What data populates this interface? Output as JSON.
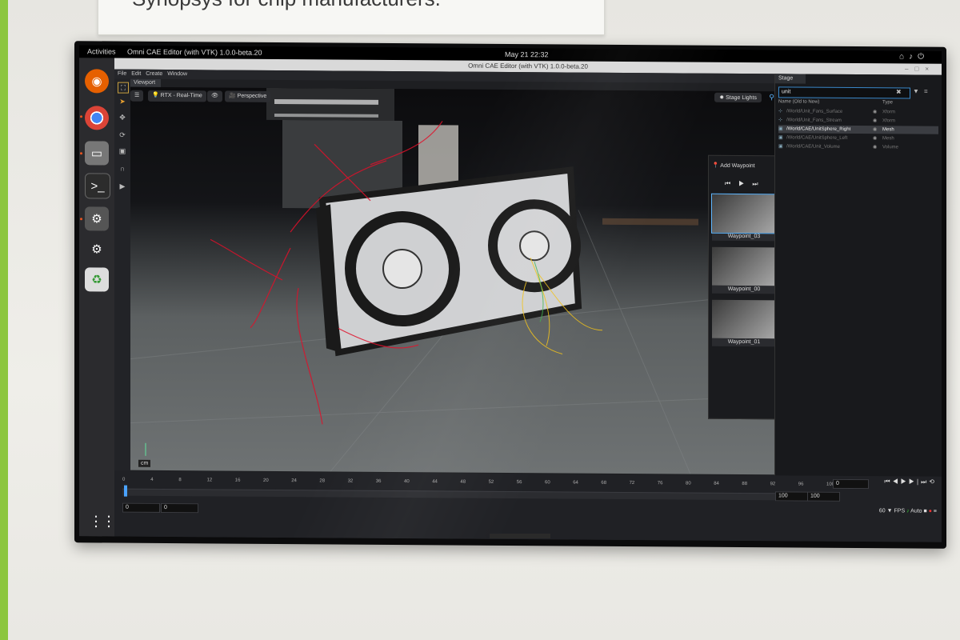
{
  "banner": {
    "text": "Synopsys for chip manufacturers."
  },
  "gnome": {
    "activities": "Activities",
    "app_title": "Omni CAE Editor (with VTK) 1.0.0-beta.20",
    "clock": "May 21  22:32",
    "tray_icons": [
      "network-icon",
      "volume-icon",
      "power-icon"
    ]
  },
  "dock": {
    "items": [
      "firefox-icon",
      "chrome-icon",
      "files-icon",
      "terminal-icon",
      "settings-icon",
      "settings-icon",
      "trash-icon"
    ],
    "apps_grid": "⋮⋮⋮"
  },
  "window": {
    "title": "Omni CAE Editor (with VTK) 1.0.0-beta.20",
    "menu": [
      "File",
      "Edit",
      "Create",
      "Window"
    ],
    "viewport_tab": "Viewport",
    "toolbar": {
      "render_mode": "RTX - Real-Time",
      "camera": "Perspective",
      "stage_lights": "Stage Lights"
    },
    "unit_label": "cm"
  },
  "waypoints": {
    "add_label": "Add Waypoint",
    "items": [
      {
        "name": "Waypoint_03",
        "selected": true
      },
      {
        "name": "Waypoint_00",
        "selected": false
      },
      {
        "name": "Waypoint_01",
        "selected": false
      }
    ]
  },
  "stage": {
    "tab": "Stage",
    "search_value": "unit",
    "columns": {
      "name": "Name (Old to New)",
      "type": "Type"
    },
    "rows": [
      {
        "name": "/World/Unit_Fans_Surface",
        "type": "Xform",
        "selected": false
      },
      {
        "name": "/World/Unit_Fans_Stream",
        "type": "Xform",
        "selected": false
      },
      {
        "name": "/World/CAE/UnitSphere_Right",
        "type": "Mesh",
        "selected": true
      },
      {
        "name": "/World/CAE/UnitSphere_Left",
        "type": "Mesh",
        "selected": false
      },
      {
        "name": "/World/CAE/Unit_Volume",
        "type": "Volume",
        "selected": false
      }
    ]
  },
  "timeline": {
    "ticks": [
      "0",
      "4",
      "8",
      "12",
      "16",
      "20",
      "24",
      "28",
      "32",
      "36",
      "40",
      "44",
      "48",
      "52",
      "56",
      "60",
      "64",
      "68",
      "72",
      "76",
      "80",
      "84",
      "88",
      "92",
      "96",
      "100"
    ],
    "current_frame": "0",
    "start": "0",
    "start2": "0",
    "end": "100",
    "end2": "100",
    "fps_value": "60",
    "fps_label": "FPS",
    "auto": "Auto",
    "playhead": 0.0
  },
  "colors": {
    "accent": "#4aa3ff",
    "stream_red": "#e0102a",
    "stream_yellow": "#f2c218"
  }
}
